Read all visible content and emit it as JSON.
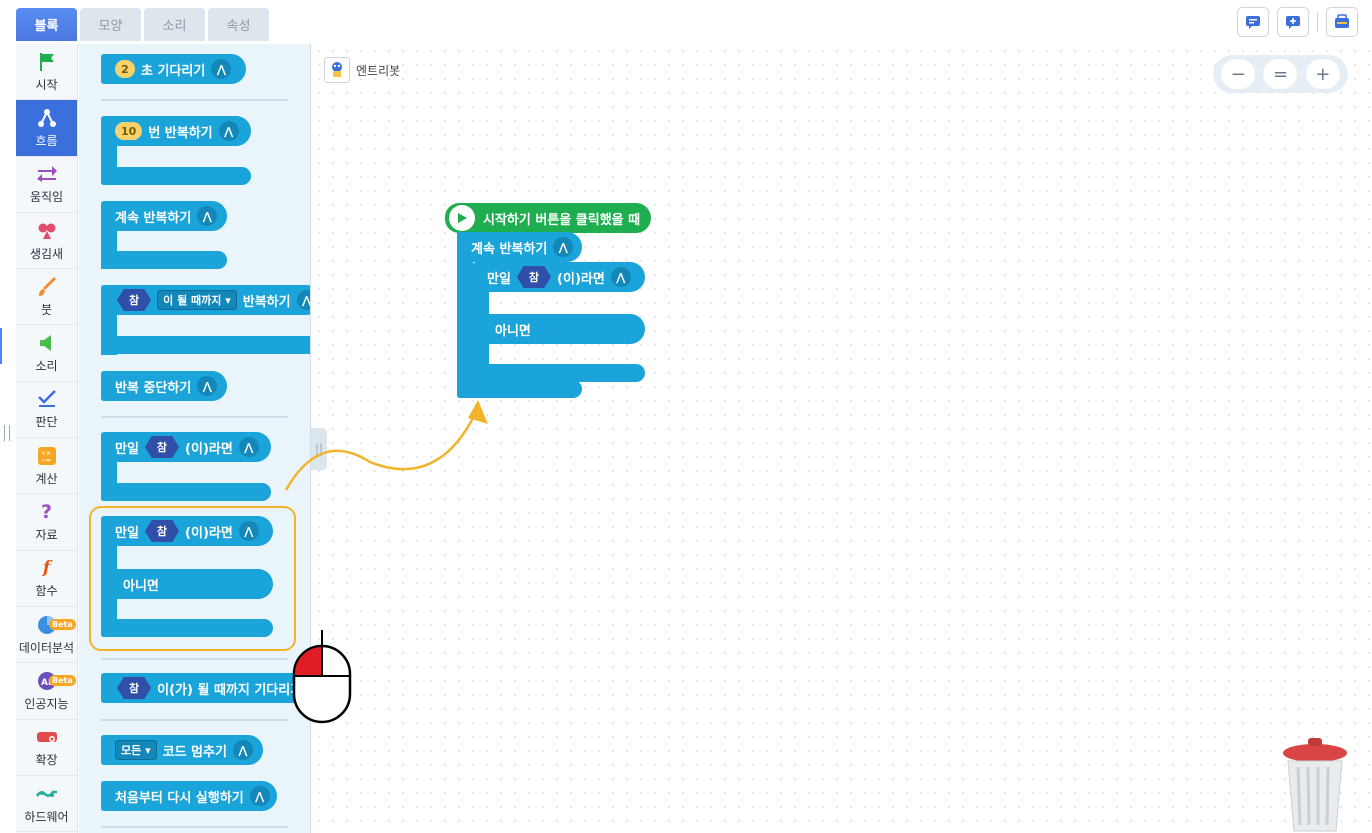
{
  "tabs": [
    {
      "label": "블록",
      "active": true
    },
    {
      "label": "모양"
    },
    {
      "label": "소리"
    },
    {
      "label": "속성"
    }
  ],
  "categories": [
    {
      "label": "시작",
      "icon": "flag-icon",
      "color": "#1fae4f"
    },
    {
      "label": "흐름",
      "icon": "flow-icon",
      "color": "#ffffff",
      "active": true
    },
    {
      "label": "움직임",
      "icon": "move-arrows-icon",
      "color": "#9b4fbf"
    },
    {
      "label": "생김새",
      "icon": "shapes-icon",
      "color": "#e24b6b"
    },
    {
      "label": "붓",
      "icon": "brush-icon",
      "color": "#f08c2e"
    },
    {
      "label": "소리",
      "icon": "speaker-icon",
      "color": "#4cba4c"
    },
    {
      "label": "판단",
      "icon": "check-icon",
      "color": "#3b6fdc"
    },
    {
      "label": "계산",
      "icon": "calculator-icon",
      "color": "#f5a623"
    },
    {
      "label": "자료",
      "icon": "question-icon",
      "color": "#9b4fbf"
    },
    {
      "label": "함수",
      "icon": "function-icon",
      "color": "#e8540e"
    },
    {
      "label": "데이터분석",
      "icon": "pie-chart-icon",
      "color": "#3b8fe0",
      "beta": "Beta"
    },
    {
      "label": "인공지능",
      "icon": "ai-icon",
      "color": "#6b4fbf",
      "beta": "Beta"
    },
    {
      "label": "확장",
      "icon": "extension-icon",
      "color": "#e24b4b"
    },
    {
      "label": "하드웨어",
      "icon": "hardware-icon",
      "color": "#1fae9f"
    }
  ],
  "palette": {
    "wait": {
      "num": "2",
      "label": "초 기다리기"
    },
    "repeat_n": {
      "num": "10",
      "label": "번 반복하기"
    },
    "repeat_forever": "계속 반복하기",
    "repeat_until": {
      "cond": "참",
      "dropdown": "이 될 때까지",
      "label": "반복하기"
    },
    "break_loop": "반복 중단하기",
    "if1": {
      "if": "만일",
      "cond": "참",
      "then": "(이)라면"
    },
    "if2": {
      "if": "만일",
      "cond": "참",
      "then": "(이)라면",
      "else": "아니면"
    },
    "wait_until": {
      "cond": "참",
      "label": "이(가) 될 때까지 기다리기"
    },
    "stop_code": {
      "dropdown": "모든",
      "label": "코드 멈추기"
    },
    "restart": "처음부터 다시 실행하기"
  },
  "canvas": {
    "object_name": "엔트리봇",
    "start_block": "시작하기 버튼을 클릭했을 때",
    "repeat_forever": "계속 반복하기",
    "if_label": "만일",
    "cond": "참",
    "then_label": "(이)라면",
    "else_label": "아니면"
  },
  "zoom": {
    "out": "−",
    "reset": "=",
    "in": "+"
  }
}
